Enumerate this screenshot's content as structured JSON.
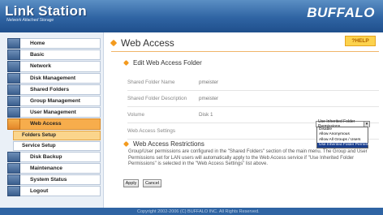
{
  "header": {
    "title": "Link Station",
    "subtitle": "Network Attached Storage",
    "brand": "BUFFALO"
  },
  "sidebar": {
    "items": [
      {
        "label": "Home"
      },
      {
        "label": "Basic"
      },
      {
        "label": "Network"
      },
      {
        "label": "Disk Management"
      },
      {
        "label": "Shared Folders"
      },
      {
        "label": "Group Management"
      },
      {
        "label": "User Management"
      },
      {
        "label": "Web Access"
      }
    ],
    "subitems": [
      {
        "label": "Folders Setup"
      },
      {
        "label": "Service Setup"
      }
    ],
    "items2": [
      {
        "label": "Disk Backup"
      },
      {
        "label": "Maintenance"
      },
      {
        "label": "System Status"
      },
      {
        "label": "Logout"
      }
    ]
  },
  "main": {
    "title": "Web Access",
    "help": "?HELP",
    "section1": "Edit Web Access Folder",
    "fields": [
      {
        "label": "Shared Folder Name",
        "value": "pmeister"
      },
      {
        "label": "Shared Folder Description",
        "value": "pmeister"
      },
      {
        "label": "Volume",
        "value": "Disk 1"
      },
      {
        "label": "Web Access Settings",
        "value": ""
      }
    ],
    "select_value": "Use Inherited Folder Permissions",
    "options": [
      "Disable",
      "Allow Anonymous",
      "Allow All Groups / Users",
      "Use Inherited Folder Permissions"
    ],
    "section2": "Web Access Restrictions",
    "description": "Group/User permissions are configured in the \"Shared Folders\" section of the main menu. The Group and User Permissions set for LAN users will automatically apply to the Web Access service if \"Use Inherited Folder Permissions\" is selected in the \"Web Access Settings\" list above.",
    "apply": "Apply",
    "cancel": "Cancel"
  },
  "footer": {
    "copyright": "Copyright 2002-2006 (C) BUFFALO INC. All Rights Reserved."
  }
}
